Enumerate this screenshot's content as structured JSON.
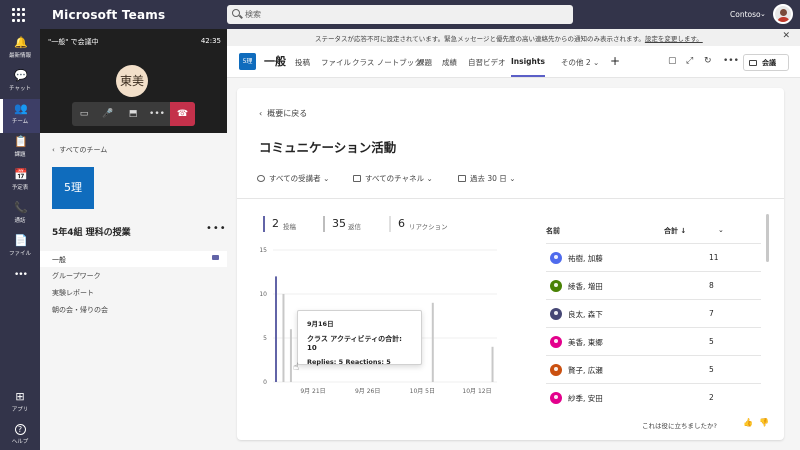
{
  "topbar": {
    "app_title": "Microsoft Teams",
    "search_placeholder": "検索",
    "org_name": "Contoso"
  },
  "rail": [
    {
      "label": "最新情報",
      "icon": "bell-icon",
      "glyph": "🔔",
      "active": false
    },
    {
      "label": "チャット",
      "icon": "chat-icon",
      "glyph": "💬",
      "active": false
    },
    {
      "label": "チーム",
      "icon": "teams-icon",
      "glyph": "👥",
      "active": true
    },
    {
      "label": "課題",
      "icon": "assignments-icon",
      "glyph": "📋",
      "active": false
    },
    {
      "label": "予定表",
      "icon": "calendar-icon",
      "glyph": "📅",
      "active": false
    },
    {
      "label": "通話",
      "icon": "phone-icon",
      "glyph": "📞",
      "active": false
    },
    {
      "label": "ファイル",
      "icon": "files-icon",
      "glyph": "📄",
      "active": false
    },
    {
      "label": "",
      "icon": "more-apps-icon",
      "glyph": "•••",
      "active": false
    },
    {
      "label": "アプリ",
      "icon": "apps-icon",
      "glyph": "⊞",
      "active": false
    },
    {
      "label": "ヘルプ",
      "icon": "help-icon",
      "glyph": "?",
      "active": false
    }
  ],
  "call": {
    "title": "\"一般\" で会議中",
    "time": "42:35",
    "avatar_initials": "東美"
  },
  "team": {
    "back_label": "すべてのチーム",
    "tile_label": "5理",
    "name": "5年4組 理科の授業",
    "channels": [
      "一般",
      "グループワーク",
      "実験レポート",
      "朝の会・帰りの会"
    ]
  },
  "notice": {
    "message": "ステータスが応答不可に設定されています。緊急メッセージと優先度の高い連絡先からの通知のみ表示されます。",
    "link": "設定を変更します。"
  },
  "tabs": {
    "tile_label": "5理",
    "channel_title": "一般",
    "items": [
      "投稿",
      "ファイル",
      "クラス ノートブック",
      "課題",
      "成績",
      "自習ビデオ",
      "Insights",
      "その他 2"
    ],
    "active": "Insights",
    "meet_label": "会議"
  },
  "content": {
    "back_label": "概要に戻る",
    "title": "コミュニケーション活動",
    "filters": [
      "すべての受講者",
      "すべてのチャネル",
      "過去 30 日"
    ],
    "stats": [
      {
        "num": "2",
        "label": "投稿",
        "color": "#6264a7"
      },
      {
        "num": "35",
        "label": "返信",
        "color": "#bdbdbd"
      },
      {
        "num": "6",
        "label": "リアクション",
        "color": "#e0e0e0"
      }
    ],
    "tooltip": {
      "date": "9月16日",
      "title": "クラス アクティビティの合計: 10",
      "detail": "Replies: 5    Reactions: 5"
    },
    "table": {
      "col_name": "名前",
      "col_total": "合計 ↓",
      "rows": [
        {
          "name": "祐樹, 加藤",
          "total": "11",
          "color": "#4f6bed"
        },
        {
          "name": "綾香, 増田",
          "total": "8",
          "color": "#498205"
        },
        {
          "name": "良太, 森下",
          "total": "7",
          "color": "#464775"
        },
        {
          "name": "美香, 東郷",
          "total": "5",
          "color": "#e3008c"
        },
        {
          "name": "賢子, 広瀬",
          "total": "5",
          "color": "#ca5010"
        },
        {
          "name": "紗季, 安田",
          "total": "2",
          "color": "#e3008c"
        }
      ]
    },
    "feedback_prompt": "これは役に立ちましたか?"
  },
  "chart_data": {
    "type": "bar",
    "ylim": [
      0,
      15
    ],
    "yticks": [
      0,
      5,
      10,
      15
    ],
    "xticks": [
      "9月 21日",
      "9月 26日",
      "10月 5日",
      "10月 12日"
    ],
    "series": [
      {
        "values": [
          12,
          10,
          6,
          0,
          0,
          0,
          0,
          0,
          0,
          0,
          0,
          0,
          0,
          0,
          0,
          0,
          0,
          0,
          0,
          0,
          0,
          9,
          0,
          0,
          0,
          0,
          0,
          0,
          0,
          4
        ]
      }
    ],
    "colors": {
      "highlight": "#6264a7",
      "default": "#c8c8c8"
    },
    "grid": true
  }
}
